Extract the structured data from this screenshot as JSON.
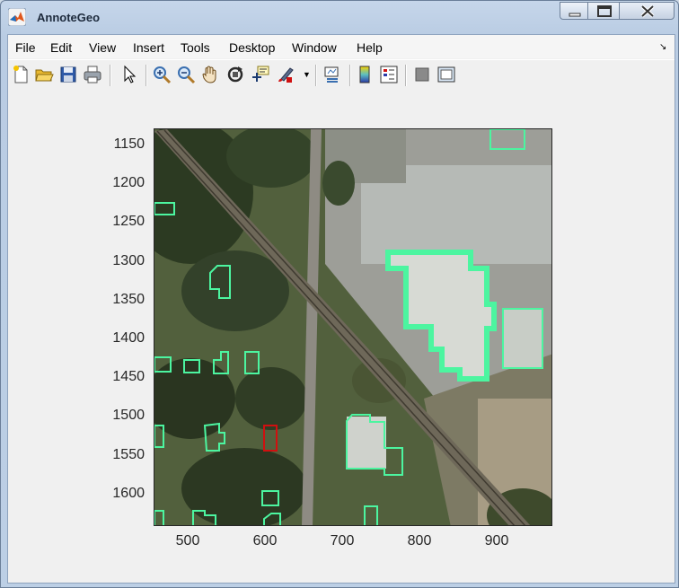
{
  "window": {
    "title": "AnnoteGeo"
  },
  "menu": [
    "File",
    "Edit",
    "View",
    "Insert",
    "Tools",
    "Desktop",
    "Window",
    "Help"
  ],
  "toolbar": {
    "buttons": [
      "new-figure-icon",
      "open-file-icon",
      "save-icon",
      "print-icon",
      "select-arrow-icon",
      "zoom-in-icon",
      "zoom-out-icon",
      "pan-hand-icon",
      "rotate-3d-icon",
      "data-cursor-icon",
      "brush-icon",
      "brush-dropdown-icon",
      "link-plot-icon",
      "colorbar-icon",
      "legend-icon",
      "hide-plot-tools-icon",
      "show-plot-tools-icon"
    ]
  },
  "axes": {
    "yticks": [
      "1150",
      "1200",
      "1250",
      "1300",
      "1350",
      "1400",
      "1450",
      "1500",
      "1550",
      "1600"
    ],
    "xticks": [
      "500",
      "600",
      "700",
      "800",
      "900"
    ]
  },
  "colors": {
    "annotation": "#4cf5a0",
    "selected": "#d01010",
    "grass": "#4e5a36",
    "trees": "#2e3a22",
    "pavement": "#a9a9a1",
    "roof": "#d9dcd6"
  }
}
